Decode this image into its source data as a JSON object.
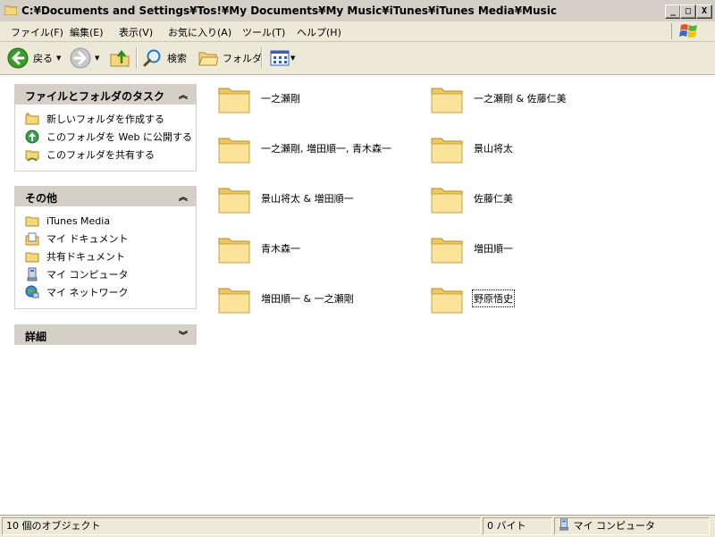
{
  "window": {
    "title": "C:¥Documents and Settings¥Tos!¥My Documents¥My Music¥iTunes¥iTunes Media¥Music",
    "minimize_label": "_",
    "maximize_label": "□",
    "close_label": "X"
  },
  "menubar": {
    "items": [
      {
        "label": "ファイル(F)"
      },
      {
        "label": "編集(E)"
      },
      {
        "label": "表示(V)"
      },
      {
        "label": "お気に入り(A)"
      },
      {
        "label": "ツール(T)"
      },
      {
        "label": "ヘルプ(H)"
      }
    ]
  },
  "toolbar": {
    "back_label": "戻る",
    "search_label": "検索",
    "folders_label": "フォルダ"
  },
  "taskpane": {
    "tasks": {
      "title": "ファイルとフォルダのタスク",
      "items": [
        {
          "label": "新しいフォルダを作成する",
          "icon": "new-folder-icon"
        },
        {
          "label": "このフォルダを Web に公開する",
          "icon": "publish-web-icon"
        },
        {
          "label": "このフォルダを共有する",
          "icon": "share-folder-icon"
        }
      ]
    },
    "other": {
      "title": "その他",
      "items": [
        {
          "label": "iTunes Media",
          "icon": "folder-icon"
        },
        {
          "label": "マイ ドキュメント",
          "icon": "my-documents-icon"
        },
        {
          "label": "共有ドキュメント",
          "icon": "shared-documents-icon"
        },
        {
          "label": "マイ コンピュータ",
          "icon": "my-computer-icon"
        },
        {
          "label": "マイ ネットワーク",
          "icon": "my-network-icon"
        }
      ]
    },
    "details": {
      "title": "詳細"
    }
  },
  "folders": [
    {
      "name": "一之瀬剛"
    },
    {
      "name": "一之瀬剛 & 佐藤仁美"
    },
    {
      "name": "一之瀬剛, 増田順一, 青木森一"
    },
    {
      "name": "景山将太"
    },
    {
      "name": "景山将太 & 増田順一"
    },
    {
      "name": "佐藤仁美"
    },
    {
      "name": "青木森一"
    },
    {
      "name": "増田順一"
    },
    {
      "name": "増田順一 & 一之瀬剛"
    },
    {
      "name": "野原悟史"
    }
  ],
  "statusbar": {
    "objects": "10 個のオブジェクト",
    "size": "0 バイト",
    "location": "マイ コンピュータ"
  }
}
